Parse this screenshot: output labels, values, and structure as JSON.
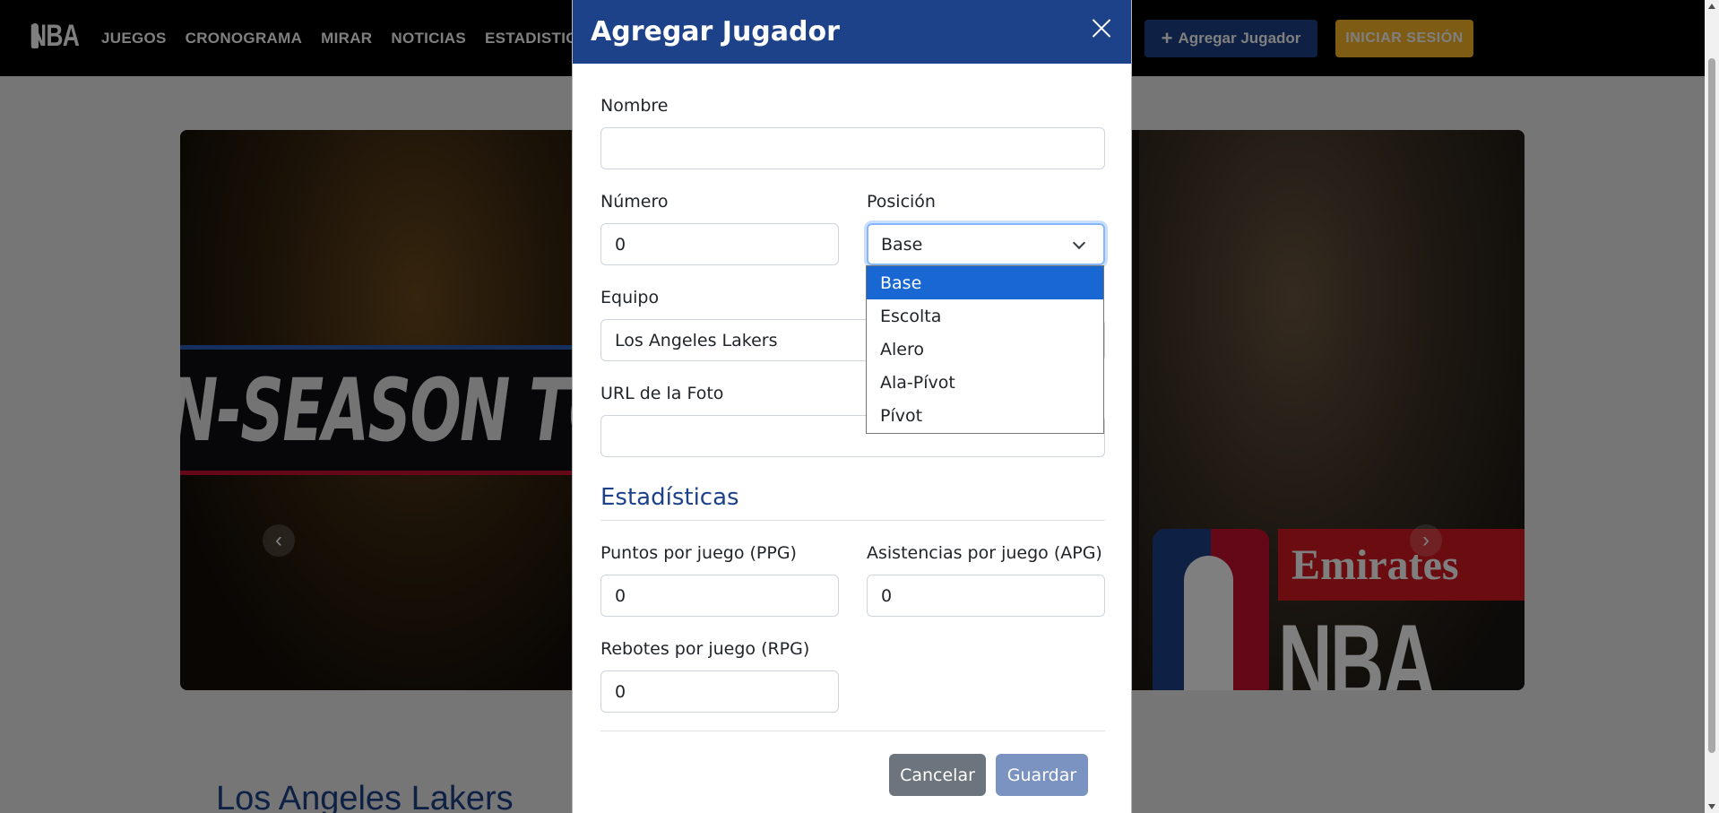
{
  "navbar": {
    "logo_text": "NBA",
    "links": [
      "JUEGOS",
      "CRONOGRAMA",
      "MIRAR",
      "NOTICIAS",
      "ESTADISTICA"
    ],
    "add_player_label": "Agregar Jugador",
    "login_label": "INICIAR SESIÓN"
  },
  "carousel": {
    "left_slide_text": "N-SEASON TOUR",
    "right_slide_brand": "Emirates",
    "right_slide_text": "NBA C"
  },
  "team_heading": "Los Angeles Lakers",
  "modal": {
    "title": "Agregar Jugador",
    "fields": {
      "nombre": {
        "label": "Nombre",
        "value": ""
      },
      "numero": {
        "label": "Número",
        "value": "0"
      },
      "posicion": {
        "label": "Posición",
        "value": "Base"
      },
      "equipo": {
        "label": "Equipo",
        "value": "Los Angeles Lakers"
      },
      "foto": {
        "label": "URL de la Foto",
        "value": ""
      }
    },
    "stats_title": "Estadísticas",
    "stats": {
      "ppg": {
        "label": "Puntos por juego (PPG)",
        "value": "0"
      },
      "apg": {
        "label": "Asistencias por juego (APG)",
        "value": "0"
      },
      "rpg": {
        "label": "Rebotes por juego (RPG)",
        "value": "0"
      }
    },
    "cancel_label": "Cancelar",
    "save_label": "Guardar"
  },
  "position_dropdown": {
    "options": [
      "Base",
      "Escolta",
      "Alero",
      "Ala-Pívot",
      "Pívot"
    ],
    "selected": "Base"
  },
  "colors": {
    "nba_blue": "#1d428a",
    "nba_gold": "#fdb927",
    "cancel_gray": "#6c757d",
    "select_highlight": "#1967d2"
  }
}
